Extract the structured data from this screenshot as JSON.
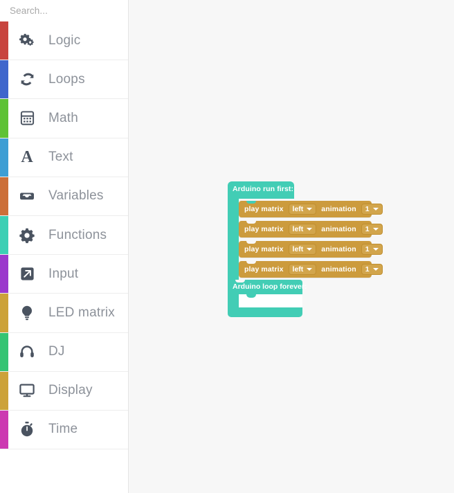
{
  "search": {
    "placeholder": "Search...",
    "value": "",
    "icon": "search-icon"
  },
  "sidebar": {
    "categories": [
      {
        "label": "Logic",
        "color": "#c8443e",
        "icon": "gears-icon"
      },
      {
        "label": "Loops",
        "color": "#3f66cc",
        "icon": "refresh-cycle-icon"
      },
      {
        "label": "Math",
        "color": "#5ec235",
        "icon": "calculator-icon"
      },
      {
        "label": "Text",
        "color": "#3e9ed4",
        "icon": "letter-a-icon"
      },
      {
        "label": "Variables",
        "color": "#cc6f38",
        "icon": "inbox-tray-icon"
      },
      {
        "label": "Functions",
        "color": "#3ccfb4",
        "icon": "gear-icon"
      },
      {
        "label": "Input",
        "color": "#9b39cc",
        "icon": "arrow-up-right-box-icon"
      },
      {
        "label": "LED matrix",
        "color": "#cca239",
        "icon": "lightbulb-icon"
      },
      {
        "label": "DJ",
        "color": "#35c473",
        "icon": "headphones-icon"
      },
      {
        "label": "Display",
        "color": "#cca239",
        "icon": "monitor-icon"
      },
      {
        "label": "Time",
        "color": "#cc39b1",
        "icon": "stopwatch-icon"
      }
    ]
  },
  "workspace": {
    "background_color": "#f7f7f7",
    "hat_block": {
      "label": "Arduino run first:",
      "color": "#42cdb5"
    },
    "statements": [
      {
        "text": "play matrix",
        "field1": "left",
        "text2": "animation",
        "field2": "1",
        "color": "#cc9b3d"
      },
      {
        "text": "play matrix",
        "field1": "left",
        "text2": "animation",
        "field2": "1",
        "color": "#cc9b3d"
      },
      {
        "text": "play matrix",
        "field1": "left",
        "text2": "animation",
        "field2": "1",
        "color": "#cc9b3d"
      },
      {
        "text": "play matrix",
        "field1": "left",
        "text2": "animation",
        "field2": "1",
        "color": "#cc9b3d"
      }
    ],
    "loop_block": {
      "label": "Arduino loop forever:",
      "color": "#42cdb5"
    }
  }
}
